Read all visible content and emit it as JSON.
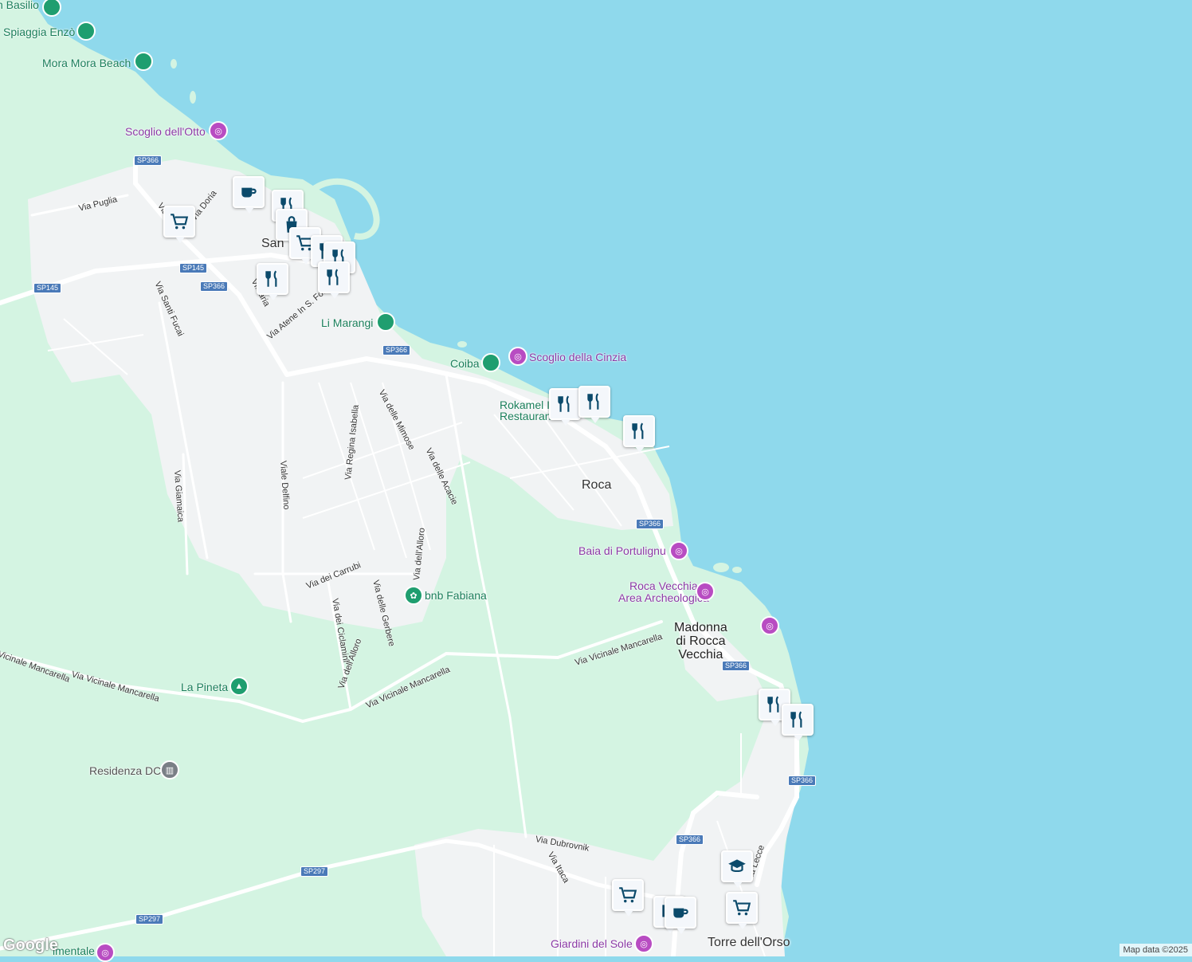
{
  "places": {
    "san_foca": "San",
    "roca": "Roca",
    "madonna": [
      "Madonna",
      "di Rocca",
      "Vecchia"
    ],
    "torre_orso": "Torre dell'Orso"
  },
  "pois": {
    "san_basilio": "n Basilio",
    "spiaggia_enzo": "Spiaggia Enzò",
    "mora_mora": "Mora Mora Beach",
    "scoglio_otto": "Scoglio dell'Otto",
    "li_marangi": "Li Marangi",
    "coiba": "Coiba",
    "scoglio_cinzia": "Scoglio della Cinzia",
    "rokamel": [
      "Rokamel I",
      "Restaurant"
    ],
    "baia_portulignu": "Baia di Portulignu",
    "roca_vecchia": [
      "Roca Vecchia",
      "Area Archeologica"
    ],
    "bnb_fabiana": "bnb Fabiana",
    "la_pineta": "La Pineta",
    "residenza_dc": "Residenza DC",
    "giardini_sole": "Giardini del Sole",
    "bottom_left": "imentale"
  },
  "streets": {
    "via_puglia": "Via Puglia",
    "via_doria": "Via Doria",
    "via_appa": "Via...appa",
    "via_santi_fucai": "Via Santi Fucai",
    "via_atene": "Via Atene In S. Foc",
    "via_maria": "Vi...aria",
    "via_giamaica": "Via Giamaica",
    "viale_delfino": "Viale Delfino",
    "via_regina_isabella": "Via Regina Isabella",
    "via_delle_mimose": "Via delle Mimose",
    "via_delle_acacie": "Via delle Acacie",
    "via_dell_alloro": "Via dell'Alloro",
    "via_dei_carrubi": "Via dei Carrubi",
    "via_delle_gerbere": "Via delle Gerbere",
    "via_dei_ciclamini": "Via dei Ciclamini",
    "via_dell_alloro2": "Via dell'Alloro",
    "via_vicinale_mancarella_1": "Via Vicinale Mancarella",
    "via_vicinale_mancarella_2": "Via Vicinale Mancarella",
    "via_vicinale_mancarella_3": "Via Vicinale Mancarella",
    "via_vicinale_mancarella_4": "Via Vicinale Mancarella",
    "via_dubrovnik": "Via Dubrovnik",
    "via_itaca": "Via Itaca",
    "via_lecce": "Via Lecce"
  },
  "road_shields": {
    "sp366_a": "SP366",
    "sp366_b": "SP366",
    "sp366_c": "SP366",
    "sp366_d": "SP366",
    "sp366_e": "SP366",
    "sp366_f": "SP366",
    "sp366_g": "SP366",
    "sp145_a": "SP145",
    "sp145_b": "SP145",
    "sp297_a": "SP297",
    "sp297_b": "SP297"
  },
  "markers": [
    "coffee-icon",
    "restaurant-icon",
    "shopping-bag-icon",
    "cart-icon",
    "restaurant-icon",
    "restaurant-icon",
    "restaurant-icon",
    "restaurant-icon",
    "restaurant-icon",
    "restaurant-icon",
    "restaurant-icon",
    "restaurant-icon",
    "restaurant-icon",
    "school-icon",
    "cart-icon",
    "cart-icon",
    "book-icon",
    "coffee-icon"
  ],
  "colors": {
    "water": "#8fd9ec",
    "land": "#d4f4e2",
    "urban": "#f1f3f4",
    "road": "#ffffff",
    "marker": "#0b4a6b"
  },
  "logo": "Google",
  "attribution": "Map data ©2025"
}
